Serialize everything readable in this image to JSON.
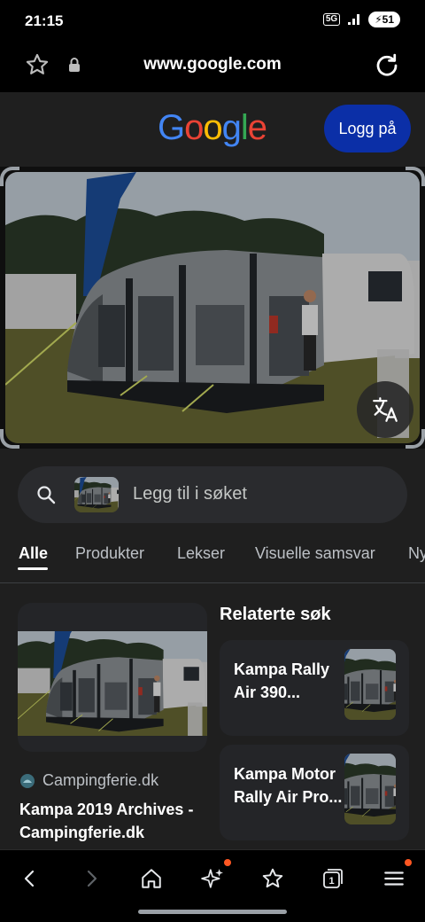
{
  "status": {
    "time": "21:15",
    "network": "5G",
    "battery": "51"
  },
  "browser": {
    "url": "www.google.com"
  },
  "header": {
    "logo_letters": [
      {
        "char": "G",
        "color": "#4285F4"
      },
      {
        "char": "o",
        "color": "#EA4335"
      },
      {
        "char": "o",
        "color": "#FBBC05"
      },
      {
        "char": "g",
        "color": "#4285F4"
      },
      {
        "char": "l",
        "color": "#34A853"
      },
      {
        "char": "e",
        "color": "#EA4335"
      }
    ],
    "login_label": "Logg på"
  },
  "search": {
    "placeholder": "Legg til i søket"
  },
  "tabs": [
    {
      "label": "Alle",
      "active": true
    },
    {
      "label": "Produkter",
      "active": false
    },
    {
      "label": "Lekser",
      "active": false
    },
    {
      "label": "Visuelle samsvar",
      "active": false
    },
    {
      "label": "Ny",
      "active": false
    }
  ],
  "result": {
    "source": "Campingferie.dk",
    "title": "Kampa 2019 Archives - Campingferie.dk"
  },
  "related": {
    "heading": "Relaterte søk",
    "items": [
      {
        "label": "Kampa Rally Air 390..."
      },
      {
        "label": "Kampa Motor Rally Air Pro..."
      }
    ]
  },
  "bottom_nav": {
    "items": [
      "back-icon",
      "forward-icon",
      "home-icon",
      "ai-sparkle-icon",
      "bookmark-icon",
      "tabs-icon",
      "menu-icon"
    ],
    "tab_count": "1",
    "accent": "#ff5722"
  }
}
